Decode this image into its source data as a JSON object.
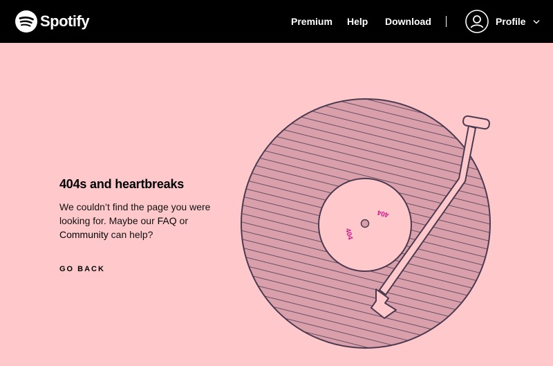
{
  "brand": {
    "name": "Spotify",
    "logo_icon": "spotify-logo-icon"
  },
  "nav": {
    "premium": "Premium",
    "help": "Help",
    "download": "Download",
    "profile": "Profile"
  },
  "icons": {
    "profile": "user-avatar-icon",
    "dropdown": "chevron-down-icon"
  },
  "error": {
    "heading": "404s and heartbreaks",
    "message_part1": "We couldn’t find the page you were looking for. Maybe our ",
    "faq_link": "FAQ",
    "message_part2": " or ",
    "community_link": "Community",
    "message_part3": " can help?",
    "go_back": "GO BACK"
  },
  "record": {
    "label_top": "404",
    "label_bottom": "404"
  },
  "colors": {
    "background": "#ffc9cc",
    "topbar": "#000000",
    "record_fill": "#d9a0ac",
    "outline": "#4b3a4f",
    "label_text": "#d21e8c"
  }
}
